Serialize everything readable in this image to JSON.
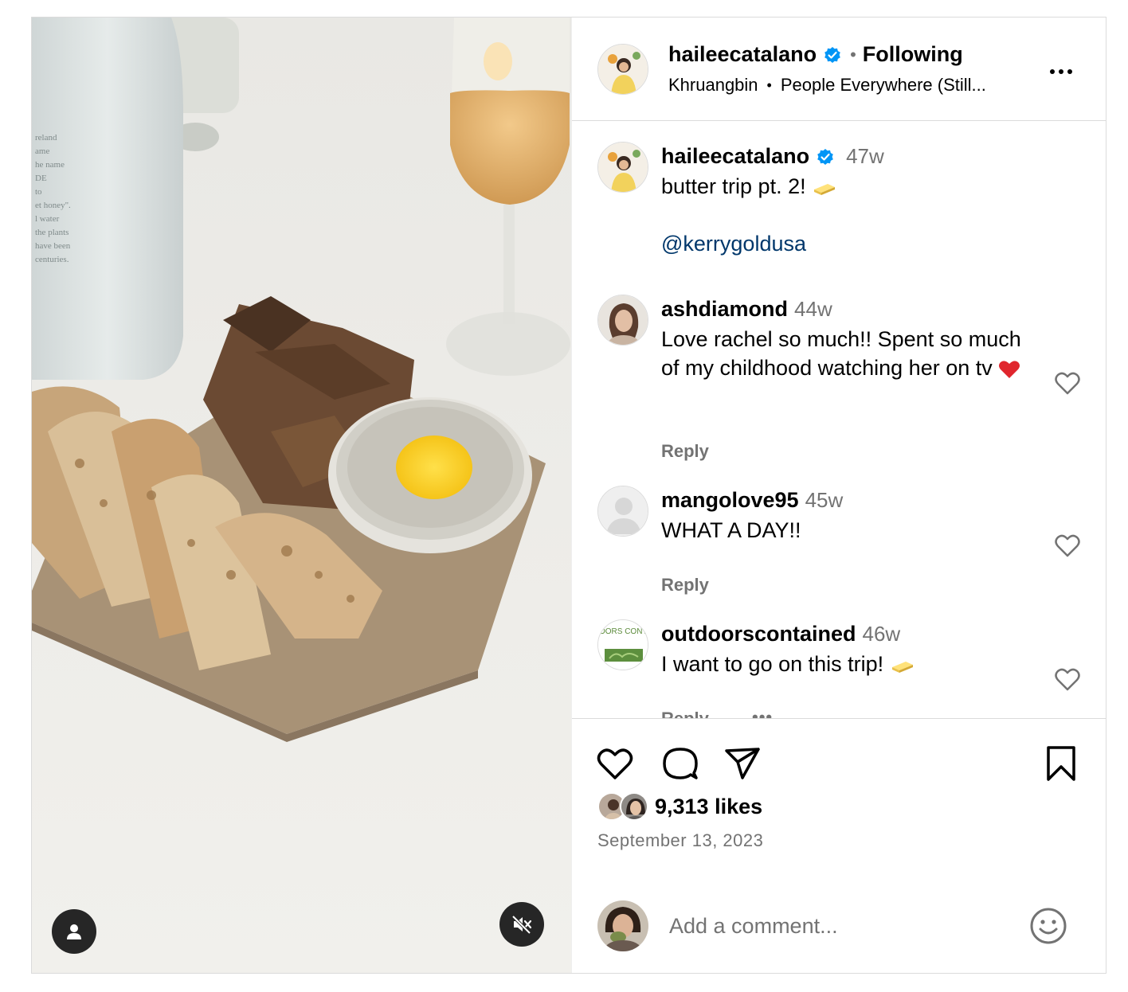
{
  "header": {
    "username": "haileecatalano",
    "separator": "•",
    "follow_status": "Following",
    "audio_artist": "Khruangbin",
    "audio_separator": "•",
    "audio_title": "People Everywhere (Still..."
  },
  "caption": {
    "username": "haileecatalano",
    "time": "47w",
    "text": "butter trip pt. 2!",
    "emoji": "butter-icon",
    "mention": "@kerrygoldusa"
  },
  "comments": [
    {
      "username": "ashdiamond",
      "time": "44w",
      "text": "Love rachel so much!! Spent so much of my childhood watching her on tv",
      "emoji": "red-heart-icon",
      "reply": "Reply"
    },
    {
      "username": "mangolove95",
      "time": "45w",
      "text": "WHAT A DAY!!",
      "reply": "Reply"
    },
    {
      "username": "outdoorscontained",
      "time": "46w",
      "text": "I want to go on this trip!",
      "emoji": "butter-icon",
      "reply": "Reply",
      "more": "•••",
      "avatar_logo_text": "OUTDOORS CONTAINED"
    }
  ],
  "likes": {
    "count_text": "9,313 likes"
  },
  "date": "September 13, 2023",
  "add_comment": {
    "placeholder": "Add a comment..."
  },
  "colors": {
    "verified": "#0095f6",
    "mention": "#00376b",
    "secondary_text": "#737373",
    "border": "#dbdbdb"
  }
}
